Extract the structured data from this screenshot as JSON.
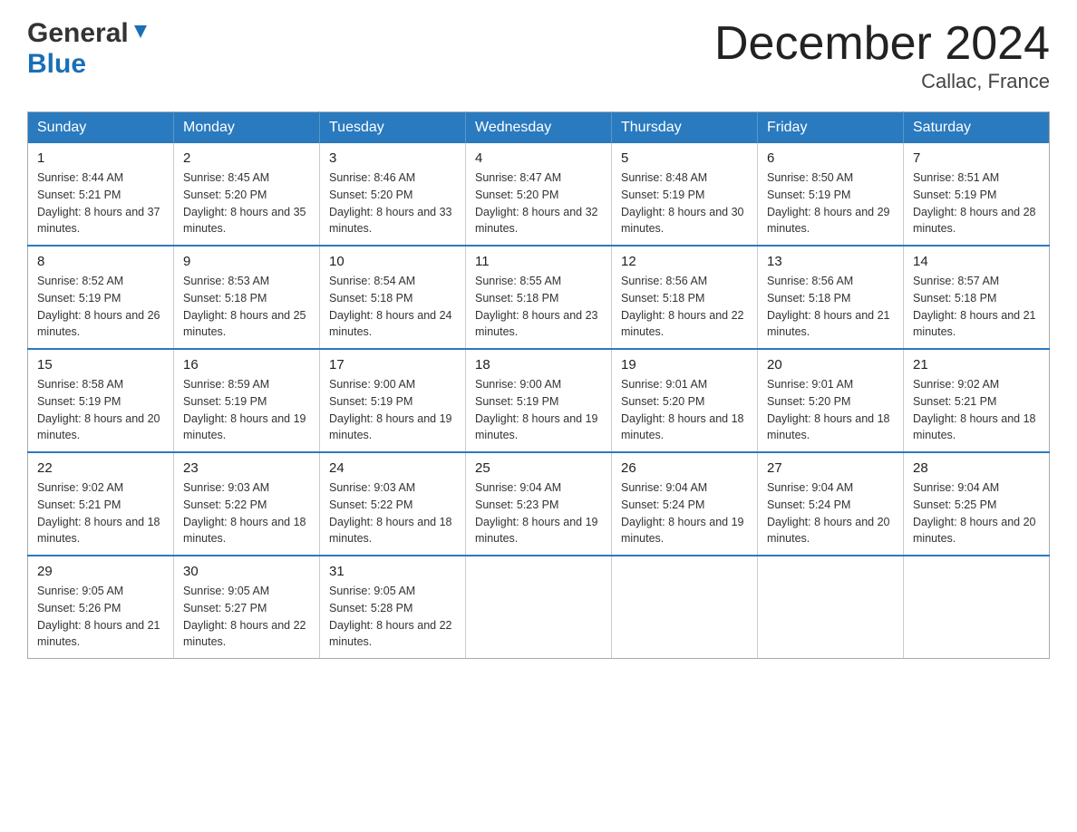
{
  "header": {
    "logo_general": "General",
    "logo_blue": "Blue",
    "title": "December 2024",
    "location": "Callac, France"
  },
  "calendar": {
    "days_of_week": [
      "Sunday",
      "Monday",
      "Tuesday",
      "Wednesday",
      "Thursday",
      "Friday",
      "Saturday"
    ],
    "weeks": [
      [
        {
          "date": "1",
          "sunrise": "8:44 AM",
          "sunset": "5:21 PM",
          "daylight": "8 hours and 37 minutes."
        },
        {
          "date": "2",
          "sunrise": "8:45 AM",
          "sunset": "5:20 PM",
          "daylight": "8 hours and 35 minutes."
        },
        {
          "date": "3",
          "sunrise": "8:46 AM",
          "sunset": "5:20 PM",
          "daylight": "8 hours and 33 minutes."
        },
        {
          "date": "4",
          "sunrise": "8:47 AM",
          "sunset": "5:20 PM",
          "daylight": "8 hours and 32 minutes."
        },
        {
          "date": "5",
          "sunrise": "8:48 AM",
          "sunset": "5:19 PM",
          "daylight": "8 hours and 30 minutes."
        },
        {
          "date": "6",
          "sunrise": "8:50 AM",
          "sunset": "5:19 PM",
          "daylight": "8 hours and 29 minutes."
        },
        {
          "date": "7",
          "sunrise": "8:51 AM",
          "sunset": "5:19 PM",
          "daylight": "8 hours and 28 minutes."
        }
      ],
      [
        {
          "date": "8",
          "sunrise": "8:52 AM",
          "sunset": "5:19 PM",
          "daylight": "8 hours and 26 minutes."
        },
        {
          "date": "9",
          "sunrise": "8:53 AM",
          "sunset": "5:18 PM",
          "daylight": "8 hours and 25 minutes."
        },
        {
          "date": "10",
          "sunrise": "8:54 AM",
          "sunset": "5:18 PM",
          "daylight": "8 hours and 24 minutes."
        },
        {
          "date": "11",
          "sunrise": "8:55 AM",
          "sunset": "5:18 PM",
          "daylight": "8 hours and 23 minutes."
        },
        {
          "date": "12",
          "sunrise": "8:56 AM",
          "sunset": "5:18 PM",
          "daylight": "8 hours and 22 minutes."
        },
        {
          "date": "13",
          "sunrise": "8:56 AM",
          "sunset": "5:18 PM",
          "daylight": "8 hours and 21 minutes."
        },
        {
          "date": "14",
          "sunrise": "8:57 AM",
          "sunset": "5:18 PM",
          "daylight": "8 hours and 21 minutes."
        }
      ],
      [
        {
          "date": "15",
          "sunrise": "8:58 AM",
          "sunset": "5:19 PM",
          "daylight": "8 hours and 20 minutes."
        },
        {
          "date": "16",
          "sunrise": "8:59 AM",
          "sunset": "5:19 PM",
          "daylight": "8 hours and 19 minutes."
        },
        {
          "date": "17",
          "sunrise": "9:00 AM",
          "sunset": "5:19 PM",
          "daylight": "8 hours and 19 minutes."
        },
        {
          "date": "18",
          "sunrise": "9:00 AM",
          "sunset": "5:19 PM",
          "daylight": "8 hours and 19 minutes."
        },
        {
          "date": "19",
          "sunrise": "9:01 AM",
          "sunset": "5:20 PM",
          "daylight": "8 hours and 18 minutes."
        },
        {
          "date": "20",
          "sunrise": "9:01 AM",
          "sunset": "5:20 PM",
          "daylight": "8 hours and 18 minutes."
        },
        {
          "date": "21",
          "sunrise": "9:02 AM",
          "sunset": "5:21 PM",
          "daylight": "8 hours and 18 minutes."
        }
      ],
      [
        {
          "date": "22",
          "sunrise": "9:02 AM",
          "sunset": "5:21 PM",
          "daylight": "8 hours and 18 minutes."
        },
        {
          "date": "23",
          "sunrise": "9:03 AM",
          "sunset": "5:22 PM",
          "daylight": "8 hours and 18 minutes."
        },
        {
          "date": "24",
          "sunrise": "9:03 AM",
          "sunset": "5:22 PM",
          "daylight": "8 hours and 18 minutes."
        },
        {
          "date": "25",
          "sunrise": "9:04 AM",
          "sunset": "5:23 PM",
          "daylight": "8 hours and 19 minutes."
        },
        {
          "date": "26",
          "sunrise": "9:04 AM",
          "sunset": "5:24 PM",
          "daylight": "8 hours and 19 minutes."
        },
        {
          "date": "27",
          "sunrise": "9:04 AM",
          "sunset": "5:24 PM",
          "daylight": "8 hours and 20 minutes."
        },
        {
          "date": "28",
          "sunrise": "9:04 AM",
          "sunset": "5:25 PM",
          "daylight": "8 hours and 20 minutes."
        }
      ],
      [
        {
          "date": "29",
          "sunrise": "9:05 AM",
          "sunset": "5:26 PM",
          "daylight": "8 hours and 21 minutes."
        },
        {
          "date": "30",
          "sunrise": "9:05 AM",
          "sunset": "5:27 PM",
          "daylight": "8 hours and 22 minutes."
        },
        {
          "date": "31",
          "sunrise": "9:05 AM",
          "sunset": "5:28 PM",
          "daylight": "8 hours and 22 minutes."
        },
        null,
        null,
        null,
        null
      ]
    ]
  }
}
